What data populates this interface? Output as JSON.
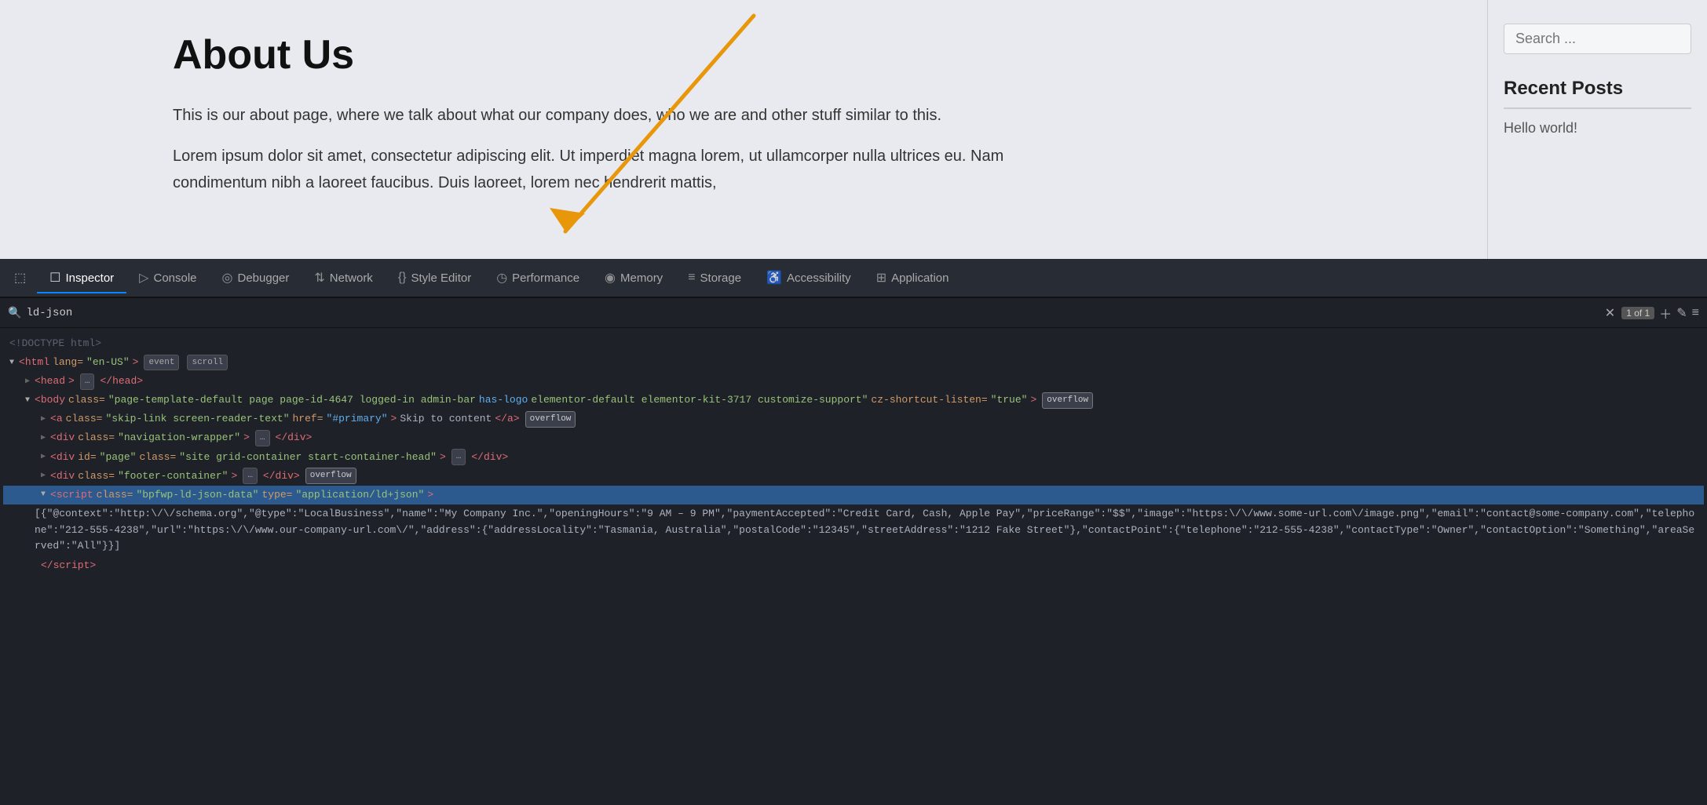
{
  "webpage": {
    "title": "About Us",
    "body_text_1": "This is our about page, where we talk about what our company does, who we are and other stuff similar to this.",
    "body_text_2": "Lorem ipsum dolor sit amet, consectetur adipiscing elit. Ut imperdiet magna lorem, ut ullamcorper nulla ultrices eu. Nam condimentum nibh a laoreet faucibus. Duis laoreet, lorem nec hendrerit mattis,",
    "search_placeholder": "Search ...",
    "sidebar_heading": "Recent Posts",
    "sidebar_link": "Hello world!"
  },
  "devtools": {
    "tabs": [
      {
        "label": "Inspector",
        "icon": "☐",
        "active": true
      },
      {
        "label": "Console",
        "icon": "▷"
      },
      {
        "label": "Debugger",
        "icon": "◎"
      },
      {
        "label": "Network",
        "icon": "↑↓"
      },
      {
        "label": "Style Editor",
        "icon": "{}"
      },
      {
        "label": "Performance",
        "icon": "◷"
      },
      {
        "label": "Memory",
        "icon": "◉"
      },
      {
        "label": "Storage",
        "icon": "≡"
      },
      {
        "label": "Accessibility",
        "icon": "♿"
      },
      {
        "label": "Application",
        "icon": "⊞"
      }
    ],
    "search_value": "ld-json",
    "search_count": "1 of 1",
    "html_lines": [
      {
        "type": "comment",
        "text": "<!DOCTYPE html>",
        "indent": 0
      },
      {
        "type": "tag_open",
        "tag": "html",
        "attrs": " lang=\"en-US\"",
        "badges": [
          "event",
          "scroll"
        ],
        "indent": 0
      },
      {
        "type": "collapsed",
        "text": "▶ <head> ... </head>",
        "indent": 0
      },
      {
        "type": "tag_open_body",
        "indent": 0
      },
      {
        "type": "a_tag",
        "indent": 1
      },
      {
        "type": "div_nav",
        "indent": 1
      },
      {
        "type": "div_page",
        "indent": 1
      },
      {
        "type": "div_footer",
        "indent": 1
      },
      {
        "type": "script_tag",
        "indent": 1
      },
      {
        "type": "script_data",
        "indent": 2
      },
      {
        "type": "script_close",
        "indent": 1
      }
    ],
    "script_data": "[{\"@context\":\"http:\\/\\/schema.org\",\"@type\":\"LocalBusiness\",\"name\":\"My Company Inc.\",\"openingHours\":\"9 AM - 9 PM\",\"paymentAccepted\":\"Credit Card, Cash, Apple Pay\",\"priceRange\":\"$$\",\"image\":\"https:\\/\\/www.some-url.com\\/image.png\",\"email\":\"contact@some-company.com\",\"telephone\":\"212-555-4238\",\"url\":\"https:\\/\\/www.our-company-url.com\\/\",\"address\":{\"addressLocality\":\"Tasmania, Australia\",\"postalCode\":\"12345\",\"streetAddress\":\"1212 Fake Street\"},\"contactPoint\":{\"telephone\":\"212-555-4238\",\"contactType\":\"Owner\",\"contactOption\":\"Something\",\"areaServed\":\"All\"}}]"
  }
}
